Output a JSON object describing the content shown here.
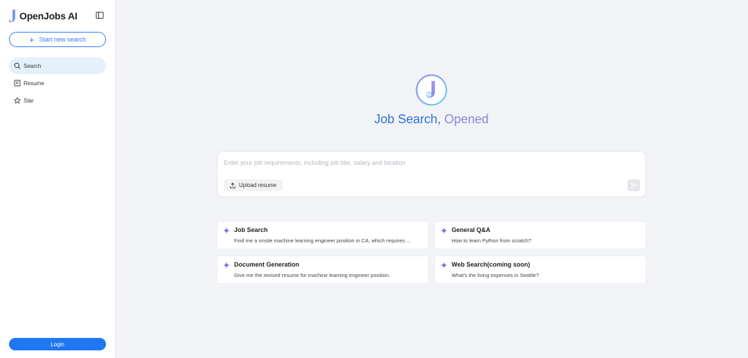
{
  "sidebar": {
    "brand_name": "OpenJobs AI",
    "new_search_label": "Start new search",
    "nav": [
      {
        "label": "Search",
        "icon": "search-icon",
        "active": true
      },
      {
        "label": "Resume",
        "icon": "resume-icon",
        "active": false
      },
      {
        "label": "Star",
        "icon": "star-icon",
        "active": false
      }
    ],
    "login_label": "Login"
  },
  "main": {
    "title_primary": "Job Search,",
    "title_accent": "Opened",
    "input_placeholder": "Enter your job requirements, including job title, salary and location",
    "upload_label": "Upload resume",
    "cards": [
      {
        "title": "Job Search",
        "desc": "Find me a onsite machine learning engineer position in CA, which requires ...",
        "icon": "sparkle-icon"
      },
      {
        "title": "General Q&A",
        "desc": "How to learn Python from scratch?",
        "icon": "sparkle-icon"
      },
      {
        "title": "Document Generation",
        "desc": "Give me the revised resume for machine learning engineer position.",
        "icon": "sparkle-icon"
      },
      {
        "title": "Web Search(coming soon)",
        "desc": "What's the living expenses in Seattle?",
        "icon": "sparkle-icon"
      }
    ]
  },
  "colors": {
    "accent": "#1f77f2",
    "title_blue": "#2b71d8",
    "title_purple": "#8a86d8",
    "sparkle": "#6f6fe6",
    "background": "#f2f3f6"
  }
}
